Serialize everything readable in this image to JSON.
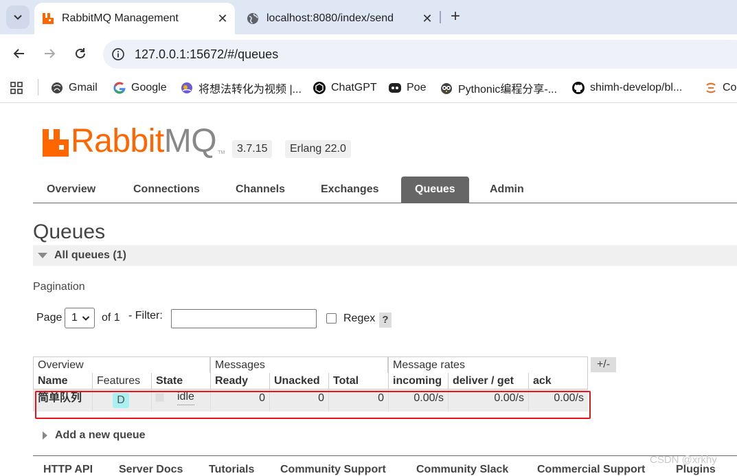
{
  "browser": {
    "tabs": [
      {
        "title": "RabbitMQ Management",
        "active": true,
        "icon": "rabbitmq-icon"
      },
      {
        "title": "localhost:8080/index/send",
        "active": false,
        "icon": "globe-icon"
      }
    ],
    "url": "127.0.0.1:15672/#/queues",
    "bookmarks": [
      {
        "label": "Gmail",
        "icon": "gmail-icon"
      },
      {
        "label": "Google",
        "icon": "google-icon"
      },
      {
        "label": "将想法转化为视频 |...",
        "icon": "video-app-icon"
      },
      {
        "label": "ChatGPT",
        "icon": "chatgpt-icon"
      },
      {
        "label": "Poe",
        "icon": "poe-icon"
      },
      {
        "label": "Pythonic编程分享-...",
        "icon": "owl-icon"
      },
      {
        "label": "shimh-develop/bl...",
        "icon": "github-icon"
      },
      {
        "label": "Co",
        "icon": "coze-icon"
      }
    ]
  },
  "app": {
    "logo_prefix": "Rabbit",
    "logo_suffix": "MQ",
    "logo_tm": "TM",
    "version": "3.7.15",
    "erlang": "Erlang 22.0",
    "nav": [
      "Overview",
      "Connections",
      "Channels",
      "Exchanges",
      "Queues",
      "Admin"
    ],
    "selected_nav": "Queues",
    "colors": {
      "accent": "#ff6600",
      "nav_selected": "#666666",
      "highlight_border": "#e8141c",
      "feature_badge": "#aaf0f0"
    }
  },
  "page": {
    "title": "Queues",
    "section": "All queues (1)",
    "pagination_label": "Pagination",
    "page_label": "Page",
    "page_value": "1",
    "of_label": "of 1",
    "filter_label": "- Filter:",
    "filter_value": "",
    "regex_label": "Regex",
    "regex_checked": false,
    "help": "?",
    "add_queue": "Add a new queue"
  },
  "table": {
    "groups": [
      "Overview",
      "Messages",
      "Message rates"
    ],
    "toggle": "+/-",
    "columns": [
      "Name",
      "Features",
      "State",
      "Ready",
      "Unacked",
      "Total",
      "incoming",
      "deliver / get",
      "ack"
    ],
    "rows": [
      {
        "name": "简单队列",
        "feature": "D",
        "state": "idle",
        "ready": "0",
        "unacked": "0",
        "total": "0",
        "incoming": "0.00/s",
        "deliver_get": "0.00/s",
        "ack": "0.00/s"
      }
    ]
  },
  "footer": [
    "HTTP API",
    "Server Docs",
    "Tutorials",
    "Community Support",
    "Community Slack",
    "Commercial Support",
    "Plugins"
  ],
  "watermark": "CSDN @xrkhy"
}
